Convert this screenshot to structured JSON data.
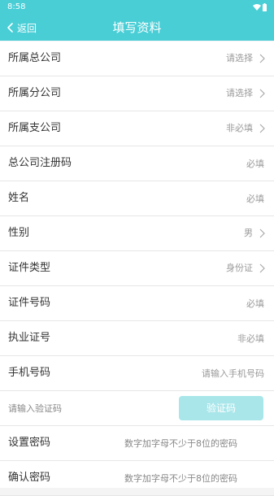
{
  "status_bar": {
    "time": "8:58",
    "wifi_icon": "wifi-icon",
    "battery_icon": "battery-icon"
  },
  "header": {
    "back_label": "返回",
    "title": "填写资料",
    "color": "#49ced6"
  },
  "form": {
    "head_company": {
      "label": "所属总公司",
      "value": "请选择"
    },
    "branch_company": {
      "label": "所属分公司",
      "value": "请选择"
    },
    "sub_branch": {
      "label": "所属支公司",
      "value": "非必填"
    },
    "reg_code": {
      "label": "总公司注册码",
      "placeholder": "必填"
    },
    "name": {
      "label": "姓名",
      "placeholder": "必填"
    },
    "gender": {
      "label": "性别",
      "value": "男"
    },
    "id_type": {
      "label": "证件类型",
      "value": "身份证"
    },
    "id_number": {
      "label": "证件号码",
      "placeholder": "必填"
    },
    "license_number": {
      "label": "执业证号",
      "placeholder": "非必填"
    },
    "phone": {
      "label": "手机号码",
      "placeholder": "请输入手机号码"
    },
    "verify": {
      "placeholder": "请输入验证码",
      "button_label": "验证码"
    },
    "password": {
      "label": "设置密码",
      "placeholder": "数字加字母不少于8位的密码"
    },
    "confirm_password": {
      "label": "确认密码",
      "placeholder": "数字加字母不少于8位的密码"
    }
  }
}
